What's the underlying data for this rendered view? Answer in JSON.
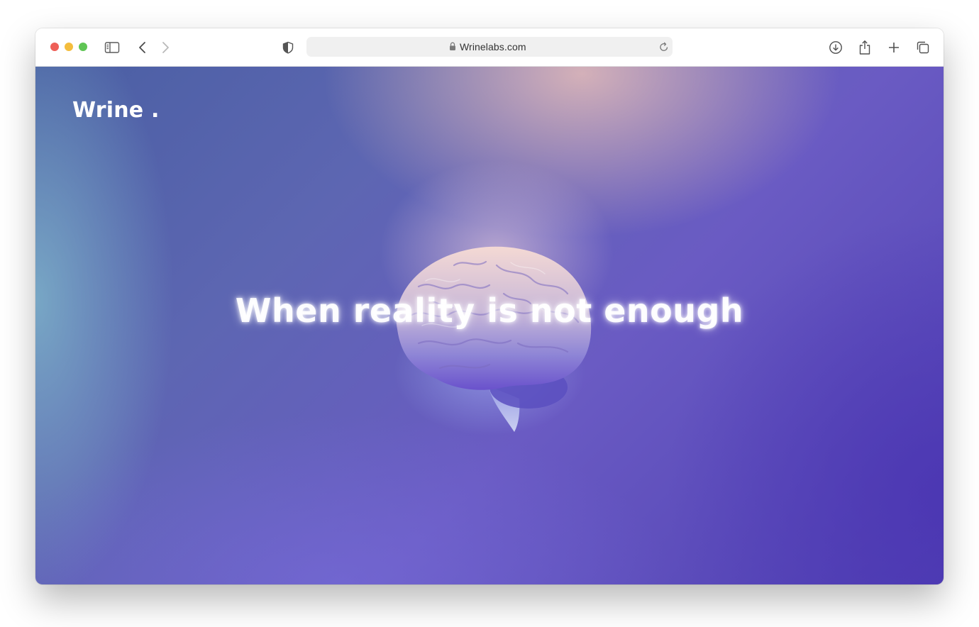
{
  "browser": {
    "url": "Wrinelabs.com",
    "icons": {
      "sidebar": "sidebar-icon",
      "back": "chevron-left-icon",
      "forward": "chevron-right-icon",
      "privacy": "shield-icon",
      "lock": "lock-icon",
      "reload": "reload-icon",
      "downloads": "download-icon",
      "share": "share-icon",
      "new_tab": "plus-icon",
      "tabs": "tabs-overview-icon"
    },
    "colors": {
      "close": "#ee5f57",
      "minimize": "#f4bd3d",
      "zoom": "#5fc554"
    }
  },
  "page": {
    "logo": "Wrine .",
    "headline": "When reality is not enough",
    "colors": {
      "background_primary": "#5d66b2",
      "background_accent": "#e8beb9",
      "text": "#ffffff"
    }
  }
}
